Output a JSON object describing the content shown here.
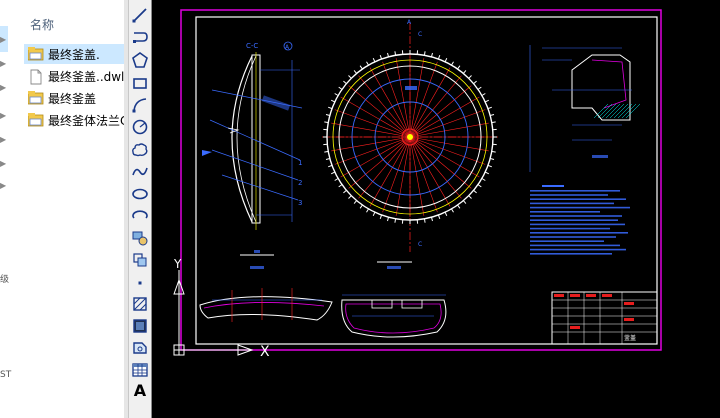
{
  "explorer": {
    "column_header": "名称",
    "files": [
      {
        "name": "最终釜盖.",
        "icon": "dwg-file-icon",
        "selected": true
      },
      {
        "name": "最终釜盖..dwl",
        "icon": "blank-file-icon",
        "selected": false
      },
      {
        "name": "最终釜盖",
        "icon": "dwg-file-icon",
        "selected": false
      },
      {
        "name": "最终釜体法兰C",
        "icon": "dwg-file-icon",
        "selected": false
      }
    ],
    "edge_text": [
      "级",
      "ST"
    ]
  },
  "toolbar": {
    "tools": [
      {
        "name": "line-tool-icon"
      },
      {
        "name": "polyline-tool-icon"
      },
      {
        "name": "polygon-tool-icon"
      },
      {
        "name": "rectangle-tool-icon"
      },
      {
        "name": "arc-tool-icon"
      },
      {
        "name": "circle-tool-icon"
      },
      {
        "name": "revision-cloud-tool-icon"
      },
      {
        "name": "spline-tool-icon"
      },
      {
        "name": "ellipse-tool-icon"
      },
      {
        "name": "ellipse-arc-tool-icon"
      },
      {
        "name": "insert-block-tool-icon"
      },
      {
        "name": "make-block-tool-icon"
      },
      {
        "name": "point-tool-icon"
      },
      {
        "name": "hatch-tool-icon"
      },
      {
        "name": "gradient-tool-icon"
      },
      {
        "name": "region-tool-icon"
      },
      {
        "name": "table-tool-icon"
      },
      {
        "name": "multiline-text-tool-icon",
        "glyph": "A"
      }
    ]
  },
  "drawing": {
    "colors": {
      "background": "#000000",
      "frame_outer": "#e000e0",
      "frame_inner": "#ffffff",
      "center_line": "#ff2020",
      "dimension": "#3a6bff",
      "object": "#ffffff",
      "accent": "#ffff00",
      "hatch": "#00ffff"
    },
    "ucs": {
      "x_label": "X",
      "y_label": "Y"
    },
    "view_labels": {
      "section": "C-C",
      "detail_mark": "A",
      "callout_1": "1",
      "callout_2": "2",
      "callout_3": "3",
      "cut_marker": "C"
    },
    "title_block": {
      "caption": "釜盖"
    }
  }
}
